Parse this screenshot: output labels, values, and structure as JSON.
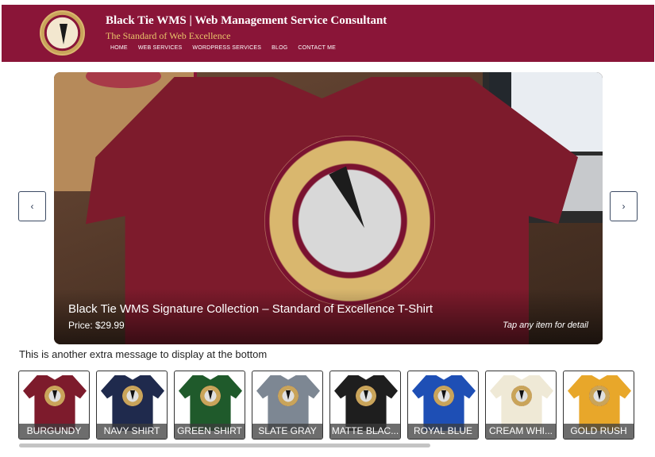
{
  "header": {
    "title": "Black Tie WMS | Web Management Service Consultant",
    "tagline": "The Standard of Web Excellence",
    "nav": [
      "HOME",
      "WEB SERVICES",
      "WORDPRESS SERVICES",
      "BLOG",
      "CONTACT ME"
    ]
  },
  "slider": {
    "title": "Black Tie WMS Signature Collection – Standard of Excellence T-Shirt",
    "price": "Price: $29.99",
    "hint": "Tap any item for detail",
    "prev": "‹",
    "next": "›"
  },
  "extra_message": "This is another extra message to display at the bottom",
  "thumbnails": [
    {
      "label": "BURGUNDY",
      "color": "#7d1b2c"
    },
    {
      "label": "NAVY SHIRT",
      "color": "#1f2a4d"
    },
    {
      "label": "GREEN SHIRT",
      "color": "#1f5a2b"
    },
    {
      "label": "SLATE GRAY",
      "color": "#7d8793"
    },
    {
      "label": "MATTE BLAC...",
      "color": "#1e1e1e"
    },
    {
      "label": "ROYAL BLUE",
      "color": "#1e4fb5"
    },
    {
      "label": "CREAM WHI...",
      "color": "#efe9d6"
    },
    {
      "label": "GOLD RUSH",
      "color": "#e8a72a"
    }
  ],
  "colors": {
    "brand": "#8a1538",
    "accent_gold": "#e9c46a"
  }
}
